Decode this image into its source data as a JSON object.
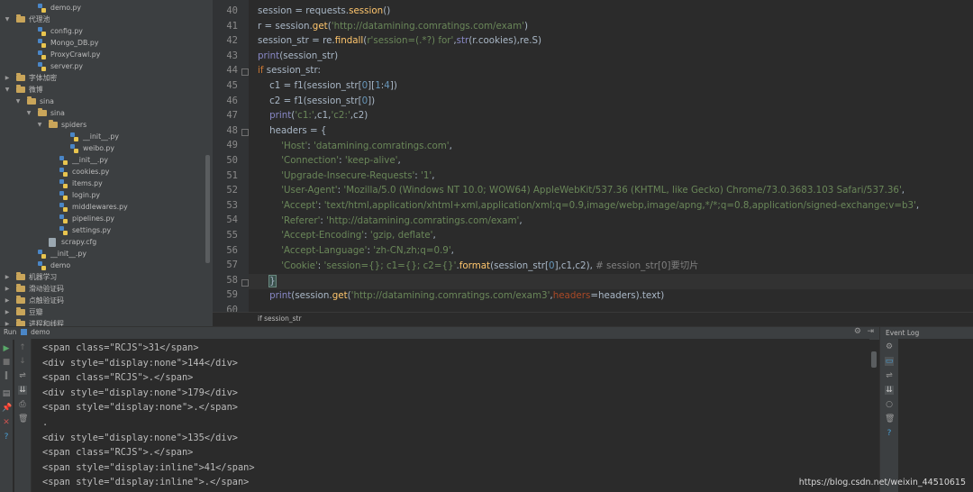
{
  "project_tree": [
    {
      "label": "demo.py",
      "type": "py",
      "depth": 3,
      "arrow": ""
    },
    {
      "label": "代理池",
      "type": "folder",
      "depth": 1,
      "arrow": "▼"
    },
    {
      "label": "config.py",
      "type": "py",
      "depth": 3,
      "arrow": ""
    },
    {
      "label": "Mongo_DB.py",
      "type": "py",
      "depth": 3,
      "arrow": ""
    },
    {
      "label": "ProxyCrawl.py",
      "type": "py",
      "depth": 3,
      "arrow": ""
    },
    {
      "label": "server.py",
      "type": "py",
      "depth": 3,
      "arrow": ""
    },
    {
      "label": "字体加密",
      "type": "folder",
      "depth": 1,
      "arrow": "▶"
    },
    {
      "label": "微博",
      "type": "folder",
      "depth": 1,
      "arrow": "▼"
    },
    {
      "label": "sina",
      "type": "folder",
      "depth": 2,
      "arrow": "▼"
    },
    {
      "label": "sina",
      "type": "folder",
      "depth": 3,
      "arrow": "▼"
    },
    {
      "label": "spiders",
      "type": "folder",
      "depth": 4,
      "arrow": "▼"
    },
    {
      "label": "__init__.py",
      "type": "py",
      "depth": 6,
      "arrow": ""
    },
    {
      "label": "weibo.py",
      "type": "py",
      "depth": 6,
      "arrow": ""
    },
    {
      "label": "__init__.py",
      "type": "py",
      "depth": 5,
      "arrow": ""
    },
    {
      "label": "cookies.py",
      "type": "py",
      "depth": 5,
      "arrow": ""
    },
    {
      "label": "items.py",
      "type": "py",
      "depth": 5,
      "arrow": ""
    },
    {
      "label": "login.py",
      "type": "py",
      "depth": 5,
      "arrow": ""
    },
    {
      "label": "middlewares.py",
      "type": "py",
      "depth": 5,
      "arrow": ""
    },
    {
      "label": "pipelines.py",
      "type": "py",
      "depth": 5,
      "arrow": ""
    },
    {
      "label": "settings.py",
      "type": "py",
      "depth": 5,
      "arrow": ""
    },
    {
      "label": "scrapy.cfg",
      "type": "cfg",
      "depth": 4,
      "arrow": ""
    },
    {
      "label": "__init__.py",
      "type": "py",
      "depth": 3,
      "arrow": ""
    },
    {
      "label": "demo",
      "type": "py",
      "depth": 3,
      "arrow": ""
    },
    {
      "label": "机器学习",
      "type": "folder",
      "depth": 1,
      "arrow": "▶"
    },
    {
      "label": "滑动验证码",
      "type": "folder",
      "depth": 1,
      "arrow": "▶"
    },
    {
      "label": "点触验证码",
      "type": "folder",
      "depth": 1,
      "arrow": "▶"
    },
    {
      "label": "豆瓣",
      "type": "folder",
      "depth": 1,
      "arrow": "▶"
    },
    {
      "label": "进程和线程",
      "type": "folder",
      "depth": 1,
      "arrow": "▶"
    }
  ],
  "editor": {
    "line_numbers": [
      "40",
      "41",
      "42",
      "43",
      "44",
      "45",
      "46",
      "47",
      "48",
      "49",
      "50",
      "51",
      "52",
      "53",
      "54",
      "55",
      "56",
      "57",
      "58",
      "59",
      "60"
    ],
    "breadcrumb": "if session_str"
  },
  "run_panel": {
    "label": "Run",
    "config_name": "demo",
    "output": [
      "<span class=\"RCJS\">31</span>",
      "<div style=\"display:none\">144</div>",
      "<span class=\"RCJS\">.</span>",
      "<div style=\"display:none\">179</div>",
      "<span style=\"display:none\">.</span>",
      ".",
      "<div style=\"display:none\">135</div>",
      "<span class=\"RCJS\">.</span>",
      "<span style=\"display:inline\">41</span>",
      "<span style=\"display:inline\">.</span>"
    ]
  },
  "event_log": {
    "title": "Event Log"
  },
  "watermark": "https://blog.csdn.net/weixin_44510615"
}
